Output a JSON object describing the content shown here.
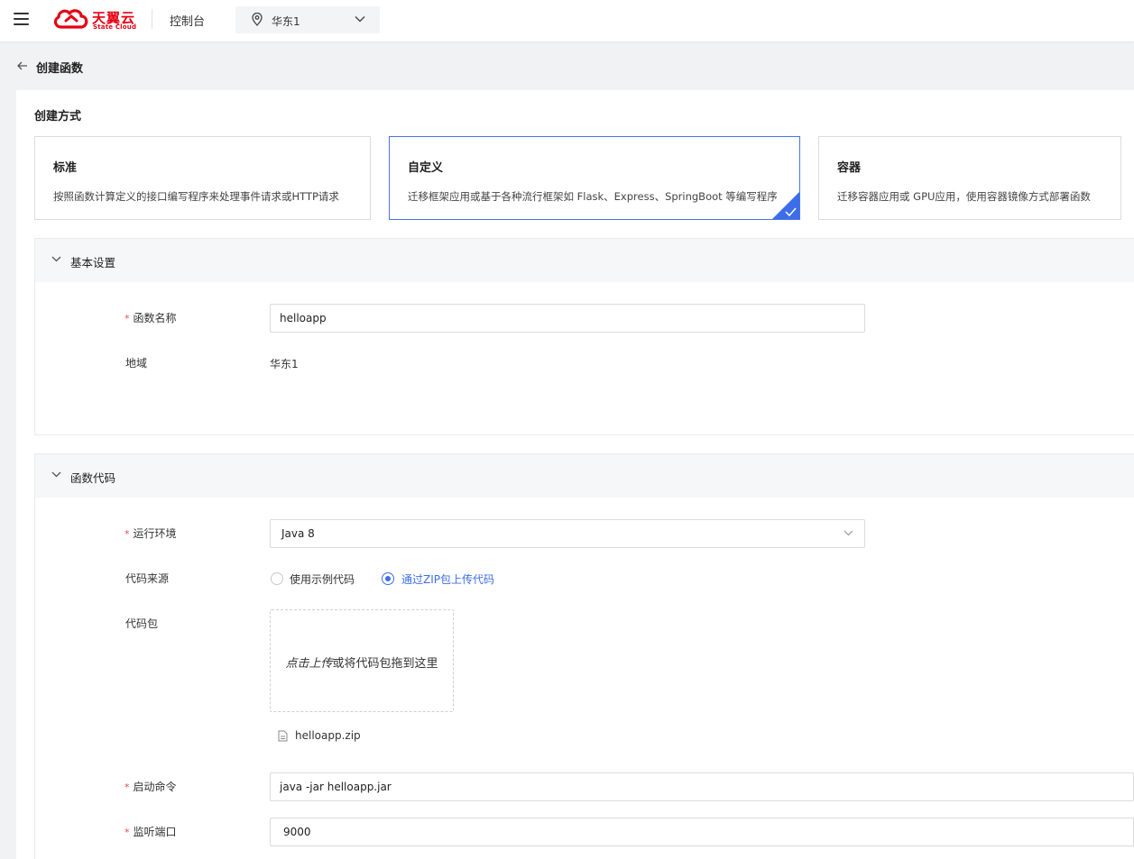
{
  "header": {
    "brand_cn": "天翼云",
    "brand_en": "State Cloud",
    "console_label": "控制台",
    "region": "华东1"
  },
  "page": {
    "title": "创建函数"
  },
  "creation": {
    "section_title": "创建方式",
    "types": [
      {
        "title": "标准",
        "desc": "按照函数计算定义的接口编写程序来处理事件请求或HTTP请求",
        "selected": false
      },
      {
        "title": "自定义",
        "desc": "迁移框架应用或基于各种流行框架如 Flask、Express、SpringBoot 等编写程序",
        "selected": true
      },
      {
        "title": "容器",
        "desc": "迁移容器应用或 GPU应用，使用容器镜像方式部署函数",
        "selected": false
      }
    ]
  },
  "basic": {
    "title": "基本设置",
    "name_label": "函数名称",
    "name_value": "helloapp",
    "region_label": "地域",
    "region_value": "华东1"
  },
  "code": {
    "title": "函数代码",
    "runtime_label": "运行环境",
    "runtime_value": "Java 8",
    "source_label": "代码来源",
    "source_options": [
      "使用示例代码",
      "通过ZIP包上传代码"
    ],
    "source_selected": 1,
    "package_label": "代码包",
    "upload_click": "点击上传",
    "upload_rest": "或将代码包拖到这里",
    "file_name": "helloapp.zip",
    "start_label": "启动命令",
    "start_value": "java -jar helloapp.jar",
    "port_label": "监听端口",
    "port_value": "9000"
  },
  "colors": {
    "brand": "#e60012",
    "accent": "#3d6de8",
    "required": "#e34d59"
  },
  "icons": [
    "menu-icon",
    "cloud-logo-icon",
    "location-pin-icon",
    "chevron-down-icon",
    "arrow-left-icon",
    "check-icon",
    "file-icon"
  ]
}
